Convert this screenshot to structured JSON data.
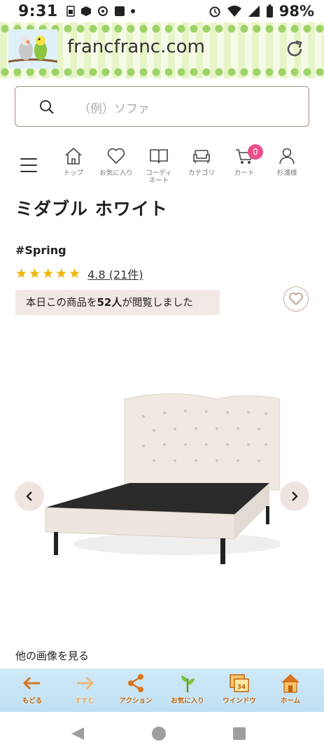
{
  "status_bar": {
    "time": "9:31",
    "battery": "98%"
  },
  "browser": {
    "url": "francfranc.com"
  },
  "search": {
    "placeholder": "（例）ソファ"
  },
  "nav": {
    "items": [
      {
        "label": "トップ",
        "icon": "home-icon"
      },
      {
        "label": "お気に入り",
        "icon": "heart-icon"
      },
      {
        "label": "コーディネート",
        "icon": "book-icon"
      },
      {
        "label": "カテゴリ",
        "icon": "sofa-icon"
      },
      {
        "label": "カート",
        "icon": "cart-icon",
        "badge": "0"
      },
      {
        "label": "杉浦様",
        "icon": "user-icon"
      }
    ]
  },
  "product": {
    "title": "ミダブル ホワイト",
    "tag": "#Spring",
    "stars": "★★★★★",
    "rating_text": "4.8 (21件)",
    "viewers_prefix": "本日この商品を",
    "viewers_count": "52人",
    "viewers_suffix": "が閲覧しました",
    "more_images": "他の画像を見る"
  },
  "toolbar": {
    "items": [
      {
        "label": "もどる",
        "icon": "back-arrow-icon"
      },
      {
        "label": "すすむ",
        "icon": "forward-arrow-icon"
      },
      {
        "label": "アクション",
        "icon": "share-icon"
      },
      {
        "label": "お気に入り",
        "icon": "plant-icon"
      },
      {
        "label": "ウインドウ",
        "icon": "window-icon",
        "count": "34"
      },
      {
        "label": "ホーム",
        "icon": "house-icon"
      }
    ]
  }
}
